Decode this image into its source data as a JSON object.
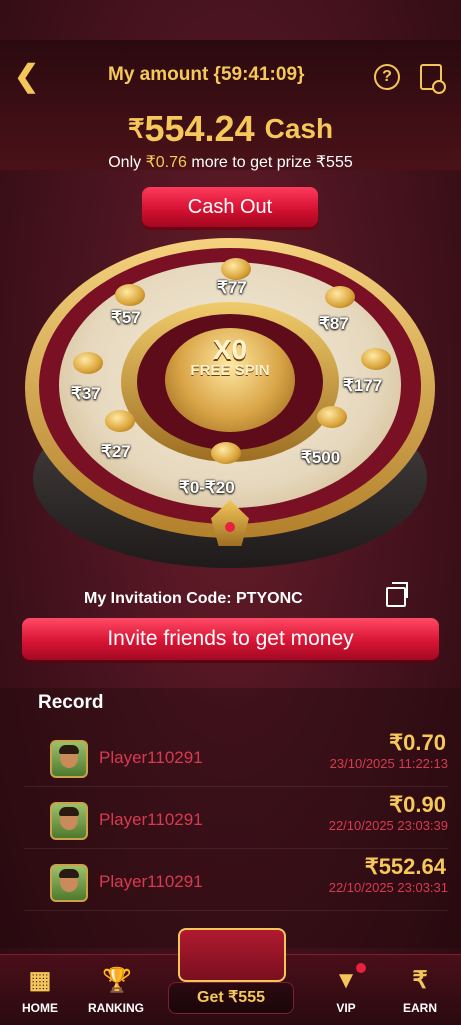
{
  "header": {
    "title": "My amount {59:41:09}",
    "currency_symbol": "₹",
    "amount": "554.24",
    "amount_unit": "Cash",
    "hint_prefix": "Only",
    "hint_amount": "₹0.76",
    "hint_suffix": "more to get prize ₹555"
  },
  "cashout": {
    "label": "Cash  Out"
  },
  "wheel": {
    "center_title": "X0",
    "center_subtitle": "FREE SPIN",
    "prizes": [
      "₹77",
      "₹87",
      "₹177",
      "₹500",
      "₹0-₹20",
      "₹27",
      "₹37",
      "₹57"
    ]
  },
  "invite": {
    "code_label": "My Invitation Code: PTYONC",
    "button_label": "Invite friends to get money"
  },
  "record": {
    "title": "Record",
    "rows": [
      {
        "name": "Player110291",
        "amount": "₹0.70",
        "time": "23/10/2025 11:22:13"
      },
      {
        "name": "Player110291",
        "amount": "₹0.90",
        "time": "22/10/2025 23:03:39"
      },
      {
        "name": "Player110291",
        "amount": "₹552.64",
        "time": "22/10/2025 23:03:31"
      }
    ]
  },
  "nav": {
    "home": "HOME",
    "ranking": "RANKING",
    "get": "Get ₹555",
    "vip": "VIP",
    "earn": "EARN"
  },
  "icons": {
    "back": "chevron-left-icon",
    "help": "question-icon",
    "rules": "document-icon",
    "copy": "copy-icon"
  },
  "colors": {
    "gold": "#f6c85a",
    "accent_red": "#d81434",
    "player_name": "#d83a52"
  }
}
